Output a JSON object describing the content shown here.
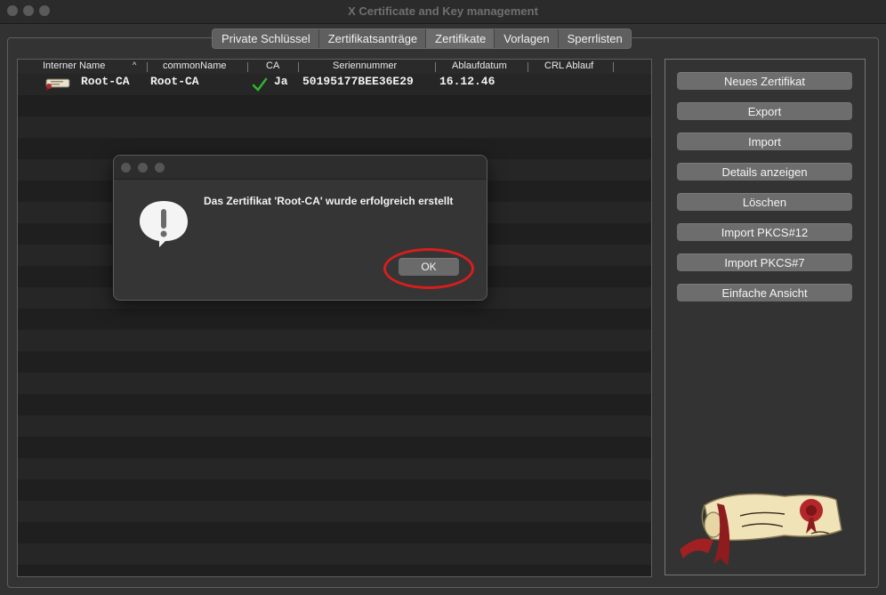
{
  "window": {
    "title": "X Certificate and Key management"
  },
  "tabs": [
    {
      "label": "Private Schlüssel"
    },
    {
      "label": "Zertifikatsanträge"
    },
    {
      "label": "Zertifikate"
    },
    {
      "label": "Vorlagen"
    },
    {
      "label": "Sperrlisten"
    }
  ],
  "table": {
    "headers": [
      "Interner Name",
      "commonName",
      "CA",
      "Seriennummer",
      "Ablaufdatum",
      "CRL Ablauf"
    ],
    "sort_indicator": "^",
    "rows": [
      {
        "internal_name": "Root-CA",
        "common_name": "Root-CA",
        "ca": "Ja",
        "serial": "50195177BEE36E29",
        "expiry": "16.12.46",
        "crl_expiry": ""
      }
    ]
  },
  "actions": [
    {
      "label": "Neues Zertifikat"
    },
    {
      "label": "Export"
    },
    {
      "label": "Import"
    },
    {
      "label": "Details anzeigen"
    },
    {
      "label": "Löschen"
    },
    {
      "label": "Import PKCS#12"
    },
    {
      "label": "Import PKCS#7"
    },
    {
      "label": "Einfache Ansicht"
    }
  ],
  "dialog": {
    "message": "Das Zertifikat 'Root-CA' wurde erfolgreich erstellt",
    "ok_label": "OK"
  },
  "colors": {
    "background": "#323232",
    "button": "#6d6d6d",
    "highlight_circle": "#d71e1e",
    "check": "#2fb52f"
  },
  "icons": [
    "certificate-icon",
    "checkmark-icon",
    "alert-icon",
    "xca-logo"
  ]
}
